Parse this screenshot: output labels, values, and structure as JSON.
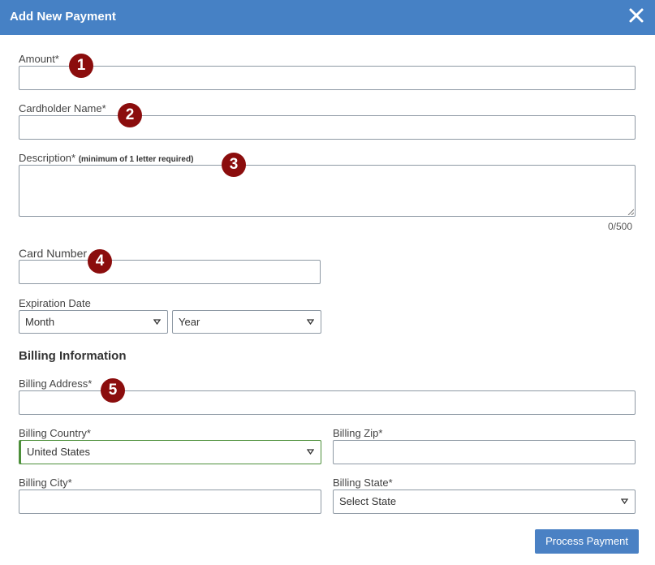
{
  "dialog": {
    "title": "Add New Payment",
    "close_icon": "close-icon"
  },
  "fields": {
    "amount": {
      "label": "Amount*",
      "value": ""
    },
    "cardholder": {
      "label": "Cardholder Name*",
      "value": ""
    },
    "description": {
      "label": "Description*",
      "hint": "(minimum of 1 letter required)",
      "value": "",
      "counter": "0/500"
    },
    "card_number": {
      "label": "Card Number",
      "value": ""
    },
    "expiration": {
      "label": "Expiration Date",
      "month": "Month",
      "year": "Year"
    }
  },
  "billing": {
    "heading": "Billing Information",
    "address": {
      "label": "Billing Address*",
      "value": ""
    },
    "country": {
      "label": "Billing Country*",
      "value": "United States"
    },
    "zip": {
      "label": "Billing Zip*",
      "value": ""
    },
    "city": {
      "label": "Billing City*",
      "value": ""
    },
    "state": {
      "label": "Billing State*",
      "value": "Select State"
    }
  },
  "badges": [
    "1",
    "2",
    "3",
    "4",
    "5"
  ],
  "actions": {
    "process_label": "Process Payment"
  },
  "colors": {
    "header": "#4681c5",
    "badge": "#8b0d0d",
    "button": "#4a81c4",
    "country_border": "#4c8f3a"
  }
}
